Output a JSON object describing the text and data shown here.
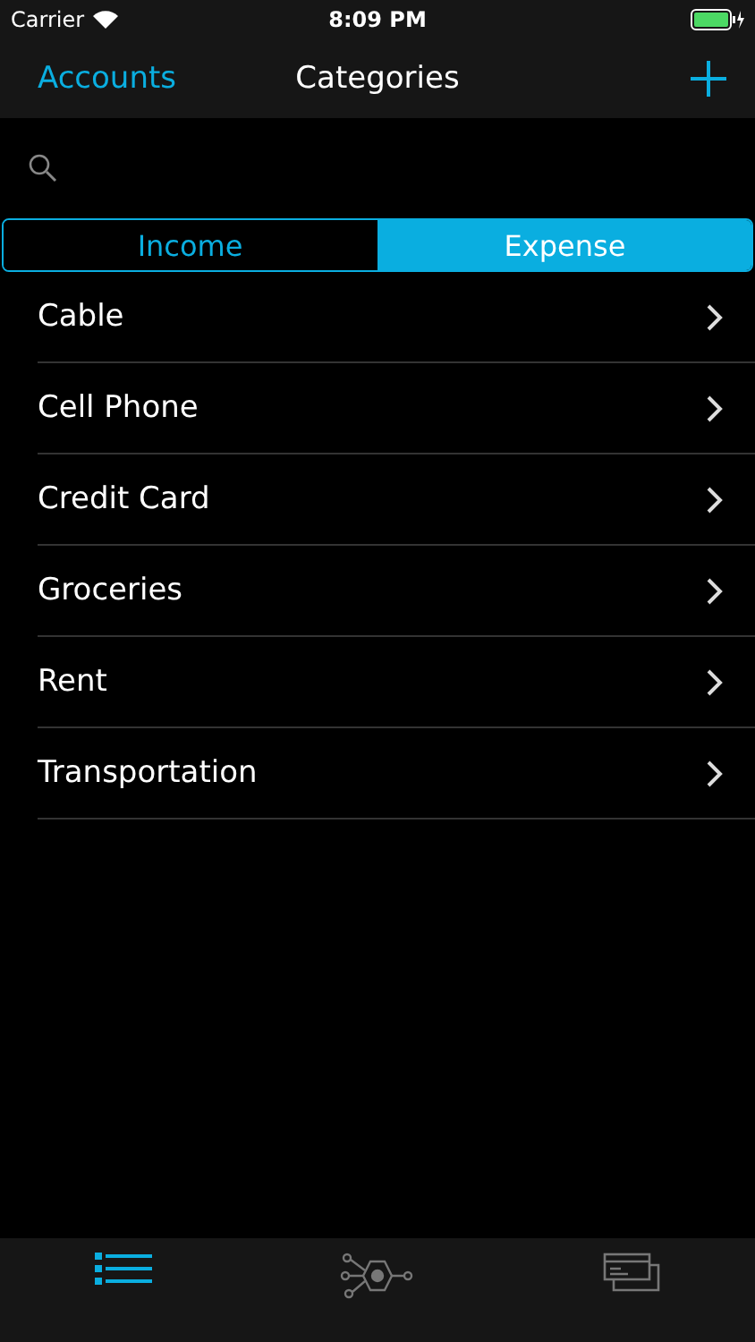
{
  "status_bar": {
    "carrier": "Carrier",
    "time": "8:09 PM"
  },
  "nav": {
    "back": "Accounts",
    "title": "Categories"
  },
  "segments": [
    {
      "label": "Income",
      "selected": false
    },
    {
      "label": "Expense",
      "selected": true
    }
  ],
  "categories": [
    "Cable",
    "Cell Phone",
    "Credit Card",
    "Groceries",
    "Rent",
    "Transportation"
  ],
  "tab_bar": [
    {
      "kind": "list",
      "selected": true
    },
    {
      "kind": "network",
      "selected": false
    },
    {
      "kind": "cards",
      "selected": false
    }
  ]
}
